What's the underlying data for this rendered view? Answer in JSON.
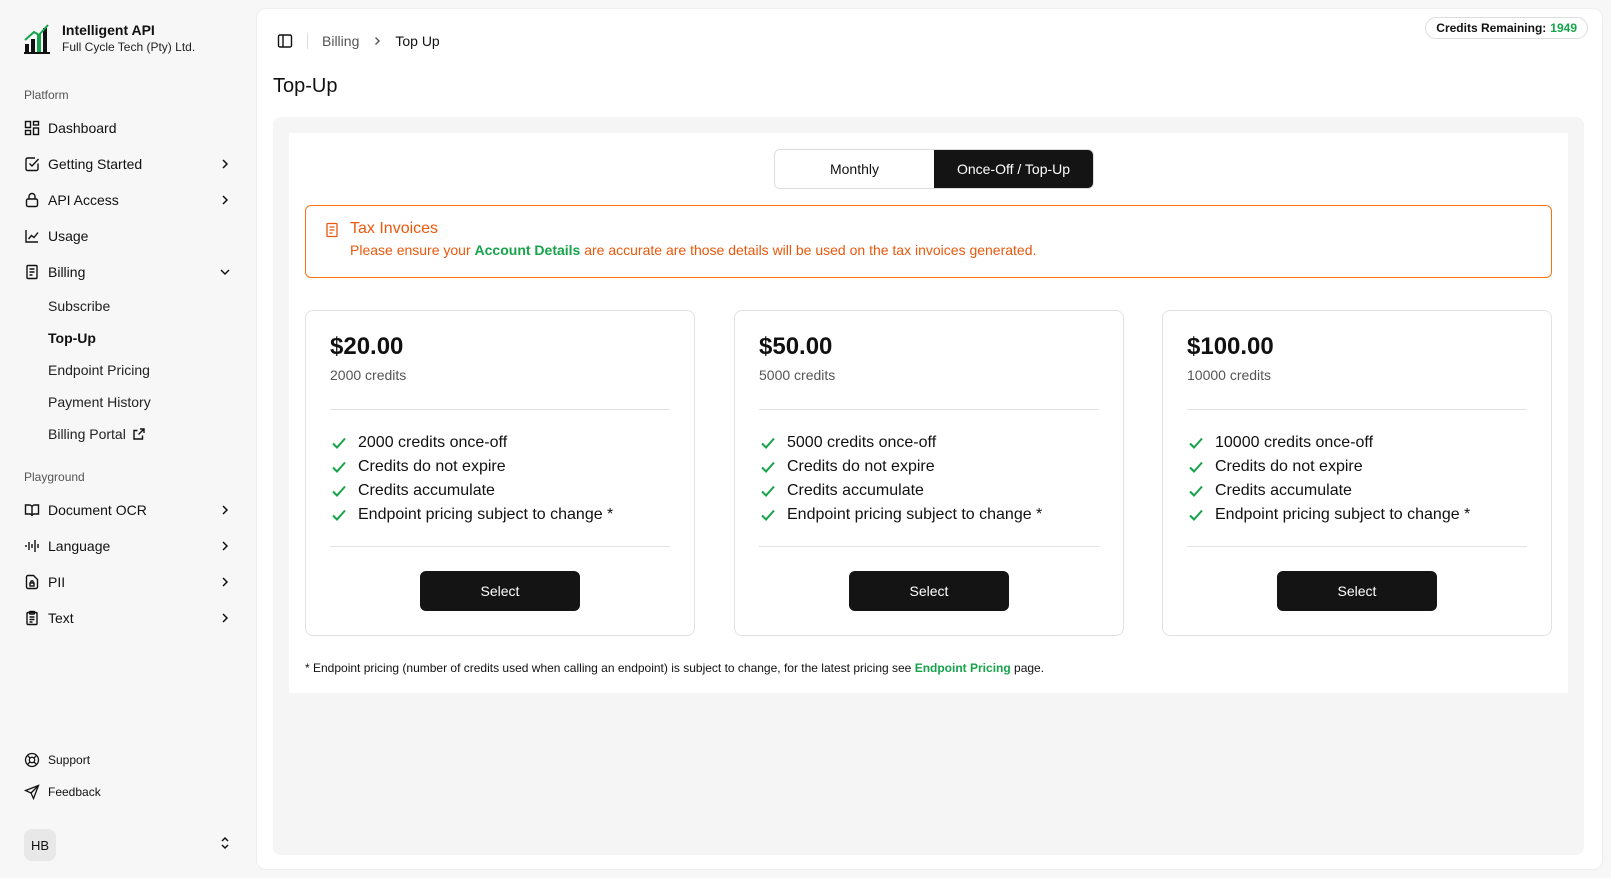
{
  "brand": {
    "title": "Intelligent API",
    "subtitle": "Full Cycle Tech (Pty) Ltd."
  },
  "sidebar": {
    "platform_label": "Platform",
    "platform_items": [
      {
        "label": "Dashboard",
        "icon": "dashboard-icon"
      },
      {
        "label": "Getting Started",
        "icon": "checkbox-icon"
      },
      {
        "label": "API Access",
        "icon": "lock-icon"
      },
      {
        "label": "Usage",
        "icon": "chart-icon"
      },
      {
        "label": "Billing",
        "icon": "receipt-icon"
      }
    ],
    "billing_sub": [
      "Subscribe",
      "Top-Up",
      "Endpoint Pricing",
      "Payment History",
      "Billing Portal"
    ],
    "playground_label": "Playground",
    "playground_items": [
      {
        "label": "Document OCR",
        "icon": "book-icon"
      },
      {
        "label": "Language",
        "icon": "audio-lines-icon"
      },
      {
        "label": "PII",
        "icon": "file-lock-icon"
      },
      {
        "label": "Text",
        "icon": "clipboard-icon"
      }
    ],
    "footer": [
      {
        "label": "Support",
        "icon": "lifebuoy-icon"
      },
      {
        "label": "Feedback",
        "icon": "send-icon"
      }
    ],
    "user_initials": "HB"
  },
  "header": {
    "breadcrumb_parent": "Billing",
    "breadcrumb_current": "Top Up",
    "credits_label": "Credits Remaining:",
    "credits_value": "1949"
  },
  "page": {
    "title": "Top-Up",
    "toggle": {
      "monthly": "Monthly",
      "once_off": "Once-Off / Top-Up"
    },
    "alert": {
      "title": "Tax Invoices",
      "before": "Please ensure your ",
      "link": "Account Details",
      "after": " are accurate are those details will be used on the tax invoices generated."
    },
    "plans": [
      {
        "price": "$20.00",
        "credits": "2000 credits",
        "features": [
          "2000 credits once-off",
          "Credits do not expire",
          "Credits accumulate",
          "Endpoint pricing subject to change *"
        ],
        "button": "Select"
      },
      {
        "price": "$50.00",
        "credits": "5000 credits",
        "features": [
          "5000 credits once-off",
          "Credits do not expire",
          "Credits accumulate",
          "Endpoint pricing subject to change *"
        ],
        "button": "Select"
      },
      {
        "price": "$100.00",
        "credits": "10000 credits",
        "features": [
          "10000 credits once-off",
          "Credits do not expire",
          "Credits accumulate",
          "Endpoint pricing subject to change *"
        ],
        "button": "Select"
      }
    ],
    "footnote": {
      "before": "* Endpoint pricing (number of credits used when calling an endpoint) is subject to change, for the latest pricing see ",
      "link": "Endpoint Pricing",
      "after": " page."
    }
  },
  "colors": {
    "accent_green": "#16a34a",
    "alert_orange": "#ea580c",
    "dark": "#141414"
  }
}
